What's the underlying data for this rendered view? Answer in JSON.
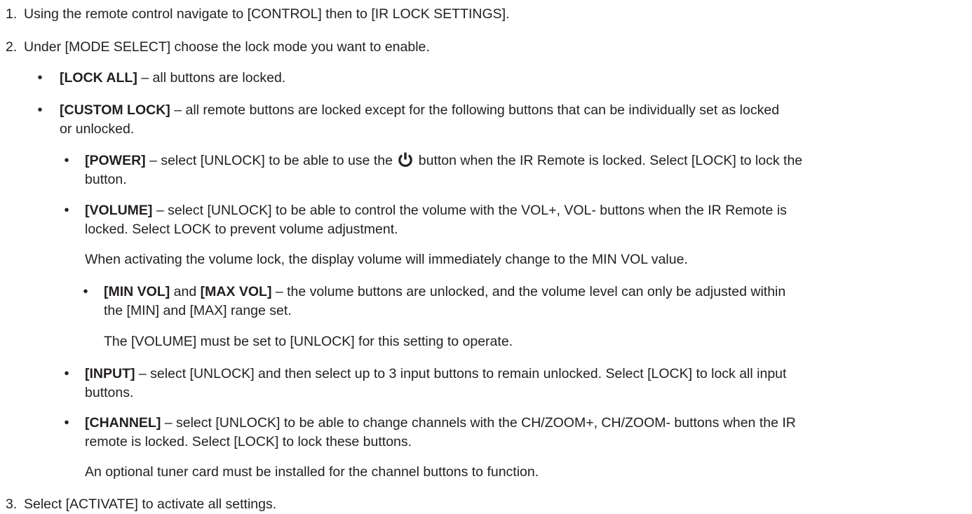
{
  "steps": [
    {
      "number": "1.",
      "text": "Using the remote control navigate to [CONTROL] then to [IR LOCK SETTINGS]."
    },
    {
      "number": "2.",
      "text": "Under [MODE SELECT] choose the lock mode you want to enable."
    },
    {
      "number": "3.",
      "text": "Select [ACTIVATE] to activate all settings."
    }
  ],
  "modes": {
    "lock_all": {
      "label": "[LOCK ALL]",
      "text": " – all buttons are locked."
    },
    "custom_lock": {
      "label": "[CUSTOM LOCK]",
      "text_line1": " – all remote buttons are locked except for the following buttons that can be individually set as locked",
      "text_line2": "or unlocked."
    }
  },
  "custom_items": {
    "power": {
      "label": "[POWER]",
      "text_before_icon": " – select [UNLOCK] to be able to use the ",
      "icon": "power-icon",
      "text_after_icon": " button when the IR Remote is locked. Select [LOCK] to lock the",
      "text_line2": "button."
    },
    "volume": {
      "label": "[VOLUME]",
      "text_line1": " – select [UNLOCK] to be able to control the volume with the VOL+, VOL- buttons when the IR Remote is",
      "text_line2": "locked. Select LOCK to prevent volume adjustment.",
      "note": "When activating the volume lock, the display volume will immediately change to the MIN VOL value."
    },
    "min_max_vol": {
      "label_min": "[MIN VOL]",
      "and": " and ",
      "label_max": "[MAX VOL]",
      "text_line1": " – the volume buttons are unlocked, and the volume level can only be adjusted within",
      "text_line2": "the [MIN] and [MAX] range set.",
      "note": "The [VOLUME] must be set to [UNLOCK] for this setting to operate."
    },
    "input": {
      "label": "[INPUT]",
      "text_line1": " – select [UNLOCK] and then select up to 3 input buttons to remain unlocked. Select [LOCK] to lock all input",
      "text_line2": "buttons."
    },
    "channel": {
      "label": "[CHANNEL]",
      "text_line1": " – select [UNLOCK] to be able to change channels with the CH/ZOOM+, CH/ZOOM- buttons when the IR",
      "text_line2": "remote is locked. Select [LOCK] to lock these buttons.",
      "note": "An optional tuner card must be installed for the channel buttons to function."
    }
  },
  "bullet_glyph": "•"
}
